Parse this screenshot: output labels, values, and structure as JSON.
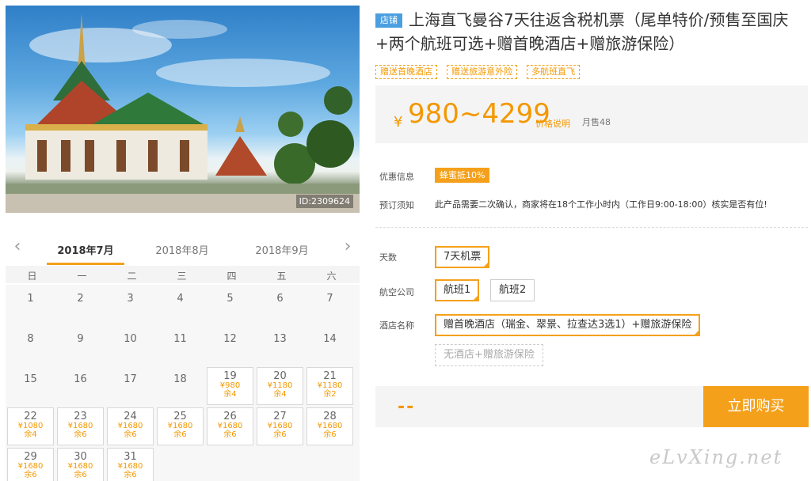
{
  "hero": {
    "id_label": "ID:2309624"
  },
  "calendar": {
    "months": [
      "2018年7月",
      "2018年8月",
      "2018年9月"
    ],
    "active_month": "2018年7月",
    "weekdays": [
      "日",
      "一",
      "二",
      "三",
      "四",
      "五",
      "六"
    ],
    "weeks": [
      [
        {
          "d": "1"
        },
        {
          "d": "2"
        },
        {
          "d": "3"
        },
        {
          "d": "4"
        },
        {
          "d": "5"
        },
        {
          "d": "6"
        },
        {
          "d": "7"
        }
      ],
      [
        {
          "d": "8"
        },
        {
          "d": "9"
        },
        {
          "d": "10"
        },
        {
          "d": "11"
        },
        {
          "d": "12"
        },
        {
          "d": "13"
        },
        {
          "d": "14"
        }
      ],
      [
        {
          "d": "15"
        },
        {
          "d": "16"
        },
        {
          "d": "17"
        },
        {
          "d": "18"
        },
        {
          "d": "19",
          "price": "¥980",
          "left": "余4"
        },
        {
          "d": "20",
          "price": "¥1180",
          "left": "余4"
        },
        {
          "d": "21",
          "price": "¥1180",
          "left": "余2"
        }
      ],
      [
        {
          "d": "22",
          "price": "¥1080",
          "left": "余4"
        },
        {
          "d": "23",
          "price": "¥1680",
          "left": "余6"
        },
        {
          "d": "24",
          "price": "¥1680",
          "left": "余6"
        },
        {
          "d": "25",
          "price": "¥1680",
          "left": "余6"
        },
        {
          "d": "26",
          "price": "¥1680",
          "left": "余6"
        },
        {
          "d": "27",
          "price": "¥1680",
          "left": "余6"
        },
        {
          "d": "28",
          "price": "¥1680",
          "left": "余6"
        }
      ],
      [
        {
          "d": "29",
          "price": "¥1680",
          "left": "余6"
        },
        {
          "d": "30",
          "price": "¥1680",
          "left": "余6"
        },
        {
          "d": "31",
          "price": "¥1680",
          "left": "余6"
        }
      ]
    ]
  },
  "product": {
    "shop_badge": "店铺",
    "title": "上海直飞曼谷7天往返含税机票（尾单特价/预售至国庆+两个航班可选+赠首晚酒店+赠旅游保险）",
    "tags": [
      "赠送首晚酒店",
      "赠送旅游意外险",
      "多航班直飞"
    ],
    "price_symbol": "¥",
    "price_range": "980~4299",
    "price_help": "价格说明",
    "monthly_sales": "月售48",
    "promo_label": "优惠信息",
    "promo_badge": "蜂蜜抵10%",
    "notice_label": "预订须知",
    "notice_text": "此产品需要二次确认，商家将在18个工作小时内（工作日9:00-18:00）核实是否有位!"
  },
  "options": {
    "days_label": "天数",
    "days": [
      "7天机票"
    ],
    "airline_label": "航空公司",
    "airlines": [
      "航班1",
      "航班2"
    ],
    "hotel_label": "酒店名称",
    "hotels": [
      "赠首晚酒店（瑞金、翠景、拉查达3选1）+赠旅游保险",
      "无酒店+赠旅游保险"
    ]
  },
  "purchase": {
    "total": "--",
    "buy_label": "立即购买"
  },
  "watermark": "eLvXing.net",
  "colors": {
    "accent": "#f5a01a",
    "price": "#f39800",
    "badge_blue": "#4a9fe0"
  }
}
